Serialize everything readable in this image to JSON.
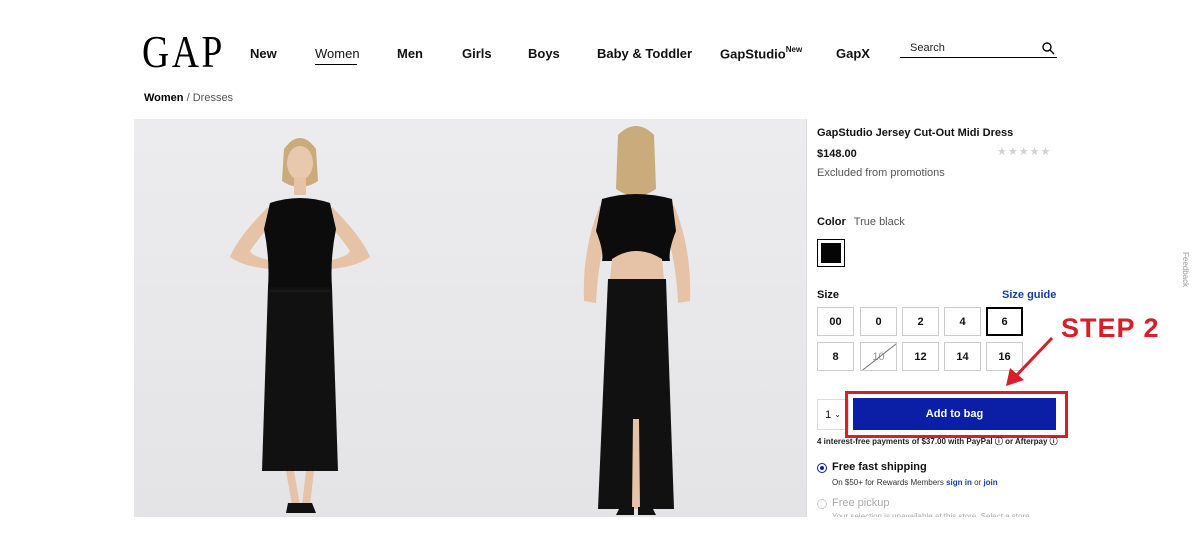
{
  "header": {
    "logo": "GAP",
    "nav": [
      {
        "label": "New"
      },
      {
        "label": "Women"
      },
      {
        "label": "Men"
      },
      {
        "label": "Girls"
      },
      {
        "label": "Boys"
      },
      {
        "label": "Baby & Toddler"
      },
      {
        "label": "GapStudio",
        "badge": "New"
      },
      {
        "label": "GapX"
      }
    ],
    "search_label": "Search"
  },
  "breadcrumb": {
    "category": "Women",
    "separator": "/",
    "subcategory": "Dresses"
  },
  "product": {
    "name": "GapStudio Jersey Cut-Out Midi Dress",
    "price": "$148.00",
    "rating_stars": "★★★★★",
    "promo_note": "Excluded from promotions",
    "color_label": "Color",
    "color_value": "True black",
    "swatch_color": "#050505",
    "size_label": "Size",
    "size_guide": "Size guide",
    "sizes": [
      "00",
      "0",
      "2",
      "4",
      "6",
      "8",
      "10",
      "12",
      "14",
      "16"
    ],
    "selected_size": "6",
    "unavailable_size": "10",
    "quantity": "1",
    "add_to_bag": "Add to bag",
    "payments_note": "4 interest-free payments of $37.00 with PayPal ⓘ or Afterpay ⓘ"
  },
  "fulfillment": {
    "ship_title": "Free fast shipping",
    "ship_sub_prefix": "On $50+ for Rewards Members",
    "sign_in": "sign in",
    "or": "or",
    "join": "join",
    "pickup_title": "Free pickup",
    "pickup_note": "Your selection is unavailable at this store. Select a store"
  },
  "annotation": {
    "step_label": "STEP 2",
    "color": "#d81e28"
  },
  "feedback_tab": "Feedback",
  "colors": {
    "accent": "#0b1ea6",
    "link": "#1a3c9e"
  }
}
